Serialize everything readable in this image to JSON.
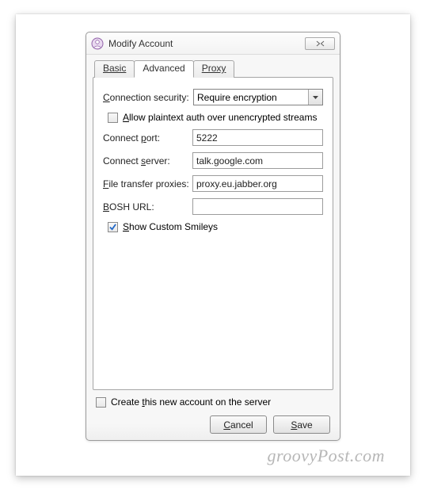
{
  "window": {
    "title": "Modify Account"
  },
  "tabs": {
    "basic": "Basic",
    "advanced": "Advanced",
    "proxy": "Proxy"
  },
  "form": {
    "connection_security": {
      "label": "Connection security:",
      "value": "Require encryption"
    },
    "allow_plaintext": {
      "label": "Allow plaintext auth over unencrypted streams",
      "checked": false
    },
    "connect_port": {
      "label": "Connect port:",
      "value": "5222"
    },
    "connect_server": {
      "label": "Connect server:",
      "value": "talk.google.com"
    },
    "file_transfer_proxies": {
      "label": "File transfer proxies:",
      "value": "proxy.eu.jabber.org"
    },
    "bosh_url": {
      "label": "BOSH URL:",
      "value": ""
    },
    "show_custom_smileys": {
      "label": "Show Custom Smileys",
      "checked": true
    }
  },
  "bottom": {
    "create_on_server": {
      "label": "Create this new account on the server",
      "checked": false
    },
    "cancel": "Cancel",
    "save": "Save"
  },
  "watermark": "groovyPost.com"
}
